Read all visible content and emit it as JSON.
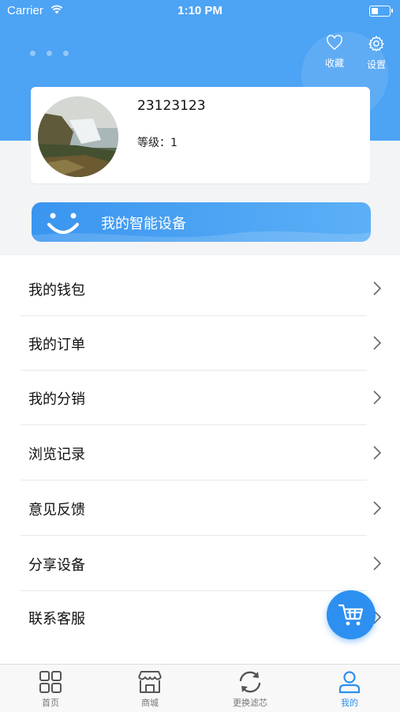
{
  "status_bar": {
    "carrier": "Carrier",
    "time": "1:10 PM"
  },
  "header": {
    "favorites_label": "收藏",
    "settings_label": "设置"
  },
  "profile": {
    "username": "23123123",
    "level_text": "等级：1"
  },
  "device_banner": {
    "label": "我的智能设备"
  },
  "menu": {
    "items": [
      {
        "label": "我的钱包"
      },
      {
        "label": "我的订单"
      },
      {
        "label": "我的分销"
      },
      {
        "label": "浏览记录"
      },
      {
        "label": "意见反馈"
      },
      {
        "label": "分享设备"
      },
      {
        "label": "联系客服"
      }
    ]
  },
  "tabbar": {
    "tabs": [
      {
        "label": "首页",
        "icon": "grid-icon"
      },
      {
        "label": "商城",
        "icon": "store-icon"
      },
      {
        "label": "更换滤芯",
        "icon": "refresh-icon"
      },
      {
        "label": "我的",
        "icon": "user-icon",
        "active": true
      }
    ]
  },
  "colors": {
    "header_blue": "#4da3f4",
    "accent": "#2d8ff0"
  }
}
